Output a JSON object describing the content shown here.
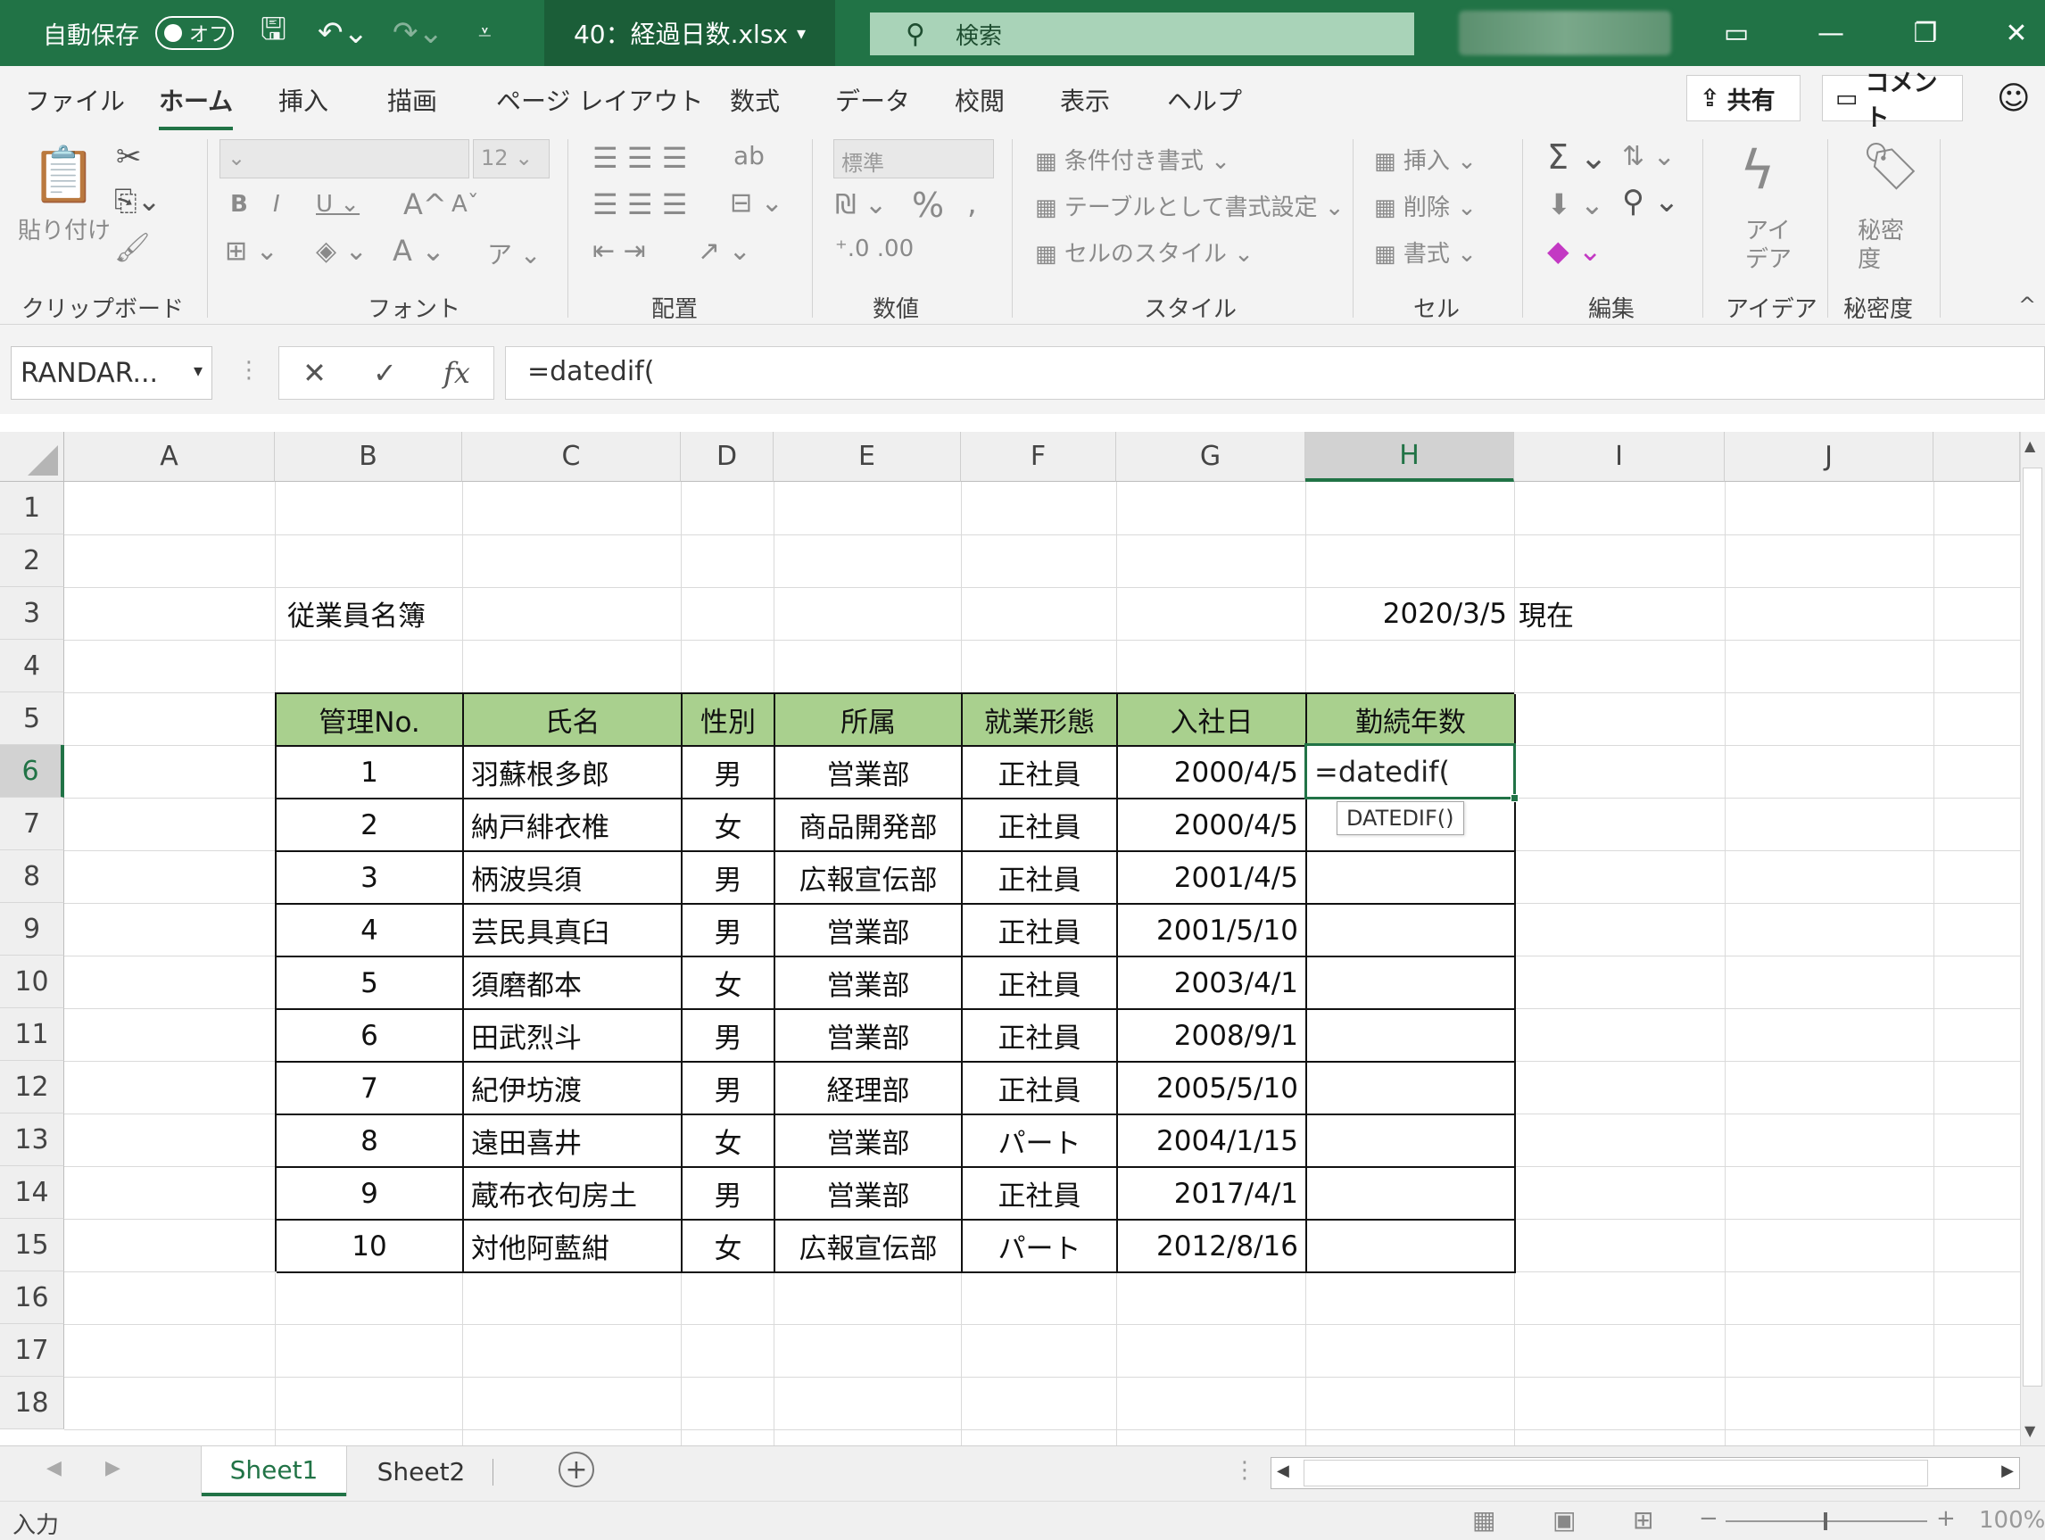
{
  "titlebar": {
    "autosave_label": "自動保存",
    "autosave_state": "オフ",
    "filename": "40：経過日数.xlsx",
    "search_placeholder": "検索"
  },
  "menu": {
    "items": [
      "ファイル",
      "ホーム",
      "挿入",
      "描画",
      "ページ レイアウト",
      "数式",
      "データ",
      "校閲",
      "表示",
      "ヘルプ"
    ],
    "active": "ホーム",
    "share_label": "共有",
    "comment_label": "コメント"
  },
  "ribbon": {
    "paste_label": "貼り付け",
    "font_size": "12",
    "number_format": "標準",
    "conditional_format": "条件付き書式",
    "format_as_table": "テーブルとして書式設定",
    "cell_styles": "セルのスタイル",
    "insert": "挿入",
    "delete": "削除",
    "format": "書式",
    "ideas_1": "アイ",
    "ideas_2": "デア",
    "sensitivity_1": "秘密",
    "sensitivity_2": "度",
    "groups": [
      "クリップボード",
      "フォント",
      "配置",
      "数値",
      "スタイル",
      "セル",
      "編集",
      "アイデア",
      "秘密度"
    ]
  },
  "formula_bar": {
    "name_box": "RANDAR...",
    "formula": "=datedif("
  },
  "grid": {
    "columns": [
      "A",
      "B",
      "C",
      "D",
      "E",
      "F",
      "G",
      "H",
      "I",
      "J"
    ],
    "selected_column": "H",
    "rows": [
      "1",
      "2",
      "3",
      "4",
      "5",
      "6",
      "7",
      "8",
      "9",
      "10",
      "11",
      "12",
      "13",
      "14",
      "15",
      "16",
      "17",
      "18"
    ],
    "selected_row": "6",
    "title": "従業員名簿",
    "as_of_date": "2020/3/5",
    "as_of_suffix": "現在",
    "table_headers": [
      "管理No.",
      "氏名",
      "性別",
      "所属",
      "就業形態",
      "入社日",
      "勤続年数"
    ],
    "table_rows": [
      [
        "1",
        "羽蘇根多郎",
        "男",
        "営業部",
        "正社員",
        "2000/4/5"
      ],
      [
        "2",
        "納戸緋衣椎",
        "女",
        "商品開発部",
        "正社員",
        "2000/4/5"
      ],
      [
        "3",
        "柄波呉須",
        "男",
        "広報宣伝部",
        "正社員",
        "2001/4/5"
      ],
      [
        "4",
        "芸民具真臼",
        "男",
        "営業部",
        "正社員",
        "2001/5/10"
      ],
      [
        "5",
        "須磨都本",
        "女",
        "営業部",
        "正社員",
        "2003/4/1"
      ],
      [
        "6",
        "田武烈斗",
        "男",
        "営業部",
        "正社員",
        "2008/9/1"
      ],
      [
        "7",
        "紀伊坊渡",
        "男",
        "経理部",
        "正社員",
        "2005/5/10"
      ],
      [
        "8",
        "遠田喜井",
        "女",
        "営業部",
        "パート",
        "2004/1/15"
      ],
      [
        "9",
        "蔵布衣句房土",
        "男",
        "営業部",
        "正社員",
        "2017/4/1"
      ],
      [
        "10",
        "対他阿藍紺",
        "女",
        "広報宣伝部",
        "パート",
        "2012/8/16"
      ]
    ],
    "active_cell_text": "=datedif(",
    "autocomplete_tip": "DATEDIF()"
  },
  "sheets": {
    "tabs": [
      "Sheet1",
      "Sheet2"
    ],
    "active": "Sheet1"
  },
  "status": {
    "mode": "入力",
    "zoom": "100%"
  },
  "colors": {
    "excel_green": "#217346",
    "table_header_fill": "#a9d08e"
  }
}
